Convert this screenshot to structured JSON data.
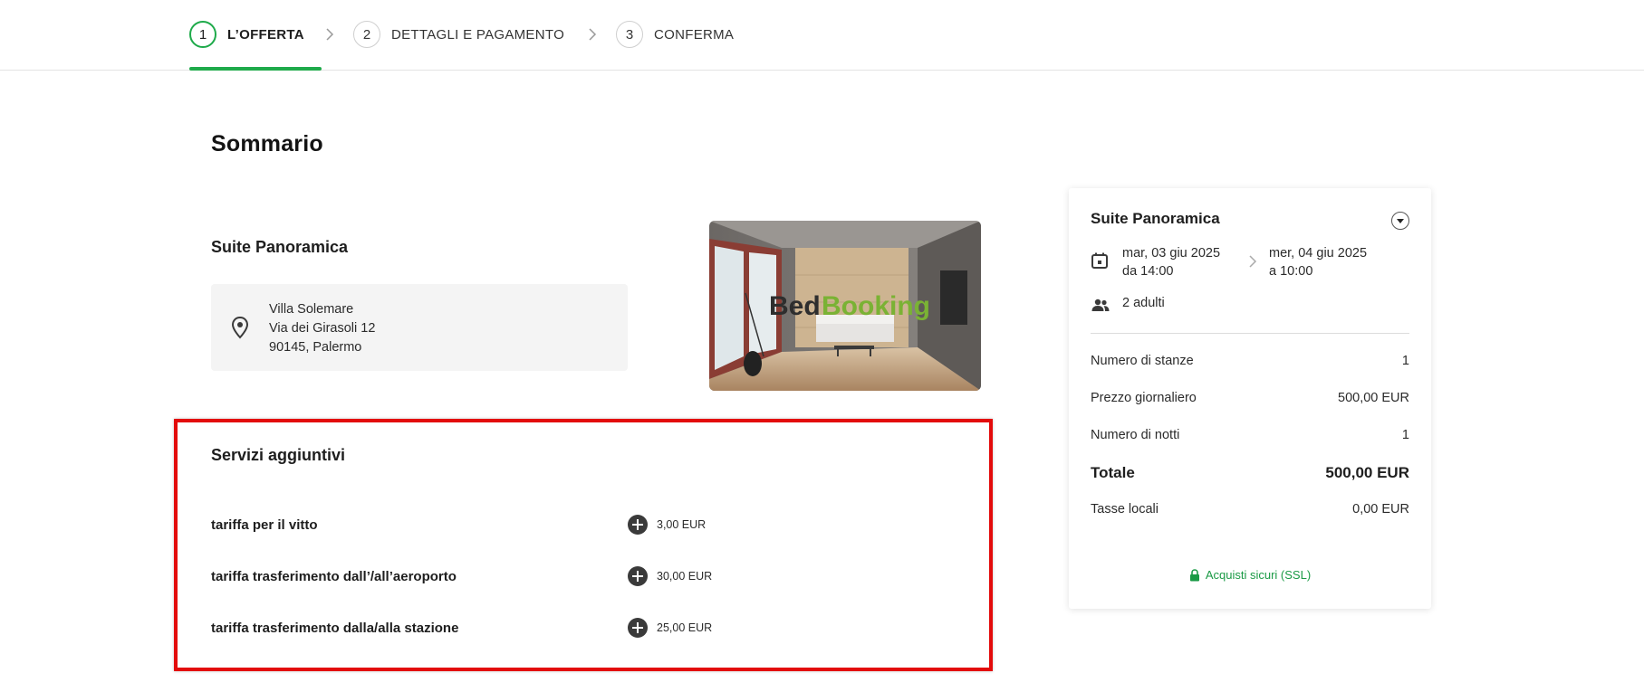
{
  "stepper": {
    "steps": [
      {
        "number": "1",
        "label": "L’OFFERTA",
        "active": true
      },
      {
        "number": "2",
        "label": "DETTAGLI E PAGAMENTO",
        "active": false
      },
      {
        "number": "3",
        "label": "CONFERMA",
        "active": false
      }
    ],
    "accent_color": "#1eaa4a"
  },
  "main": {
    "page_title": "Sommario",
    "room_title": "Suite Panoramica",
    "address": {
      "line1": "Villa Solemare",
      "line2": "Via dei Girasoli 12",
      "line3": "90145, Palermo",
      "icon": "map-pin-icon"
    },
    "image": {
      "watermark_part1": "Bed",
      "watermark_part2": "Booking"
    }
  },
  "services": {
    "title": "Servizi aggiuntivi",
    "items": [
      {
        "name": "tariffa per il vitto",
        "price": "3,00 EUR"
      },
      {
        "name": "tariffa trasferimento dall’/all’aeroporto",
        "price": "30,00 EUR"
      },
      {
        "name": "tariffa trasferimento dalla/alla stazione",
        "price": "25,00 EUR"
      }
    ],
    "highlight_color": "#e30b0b"
  },
  "summary": {
    "title": "Suite Panoramica",
    "checkin_date": "mar, 03 giu 2025",
    "checkin_time": "da 14:00",
    "checkout_date": "mer, 04 giu 2025",
    "checkout_time": "a 10:00",
    "guests": "2 adulti",
    "rows": [
      {
        "label": "Numero di stanze",
        "value": "1"
      },
      {
        "label": "Prezzo giornaliero",
        "value": "500,00 EUR"
      },
      {
        "label": "Numero di notti",
        "value": "1"
      },
      {
        "label": "Totale",
        "value": "500,00 EUR"
      },
      {
        "label": "Tasse locali",
        "value": "0,00 EUR"
      }
    ],
    "secure_label": "Acquisti sicuri (SSL)",
    "secure_color": "#1a9a45"
  }
}
